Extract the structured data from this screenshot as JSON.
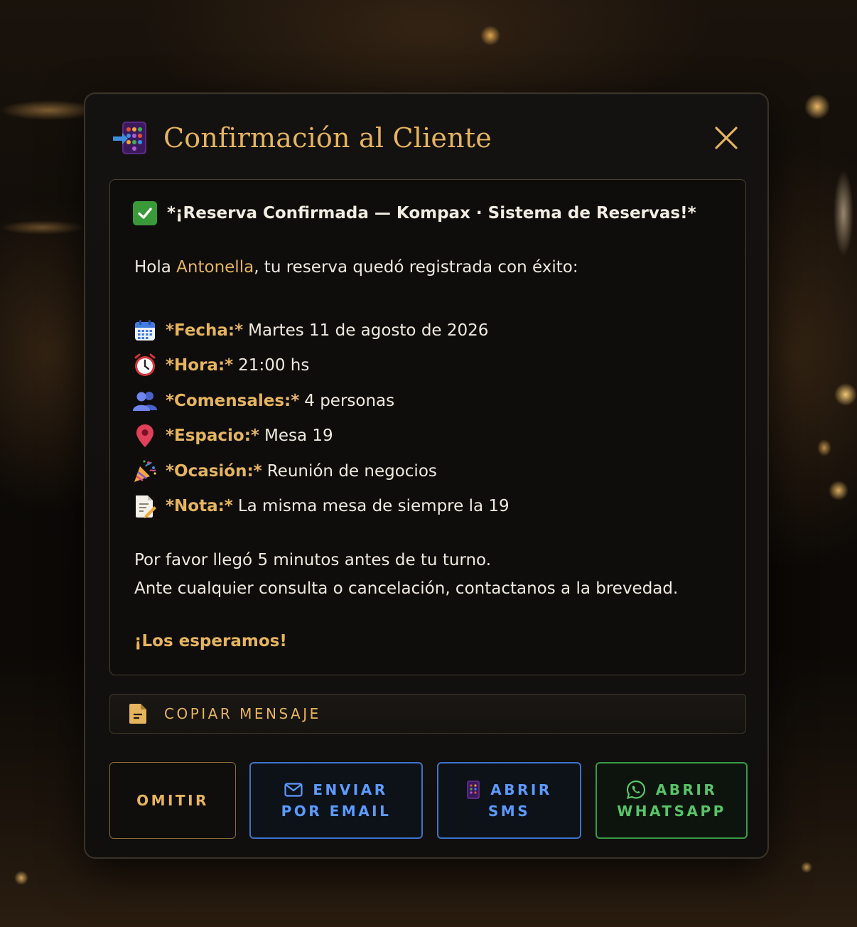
{
  "modal": {
    "title": "Confirmación al Cliente",
    "app_icon": "app-grid-icon",
    "close_icon": "close-icon"
  },
  "message": {
    "title": "*¡Reserva Confirmada — Kompax · Sistema de Reservas!*",
    "greeting_prefix": "Hola ",
    "customer_name": "Antonella",
    "greeting_suffix": ", tu reserva quedó registrada con éxito:",
    "details": [
      {
        "icon": "calendar-icon",
        "label": "*Fecha:*",
        "value": "Martes 11 de agosto de 2026"
      },
      {
        "icon": "alarm-clock-icon",
        "label": "*Hora:*",
        "value": "21:00 hs"
      },
      {
        "icon": "people-icon",
        "label": "*Comensales:*",
        "value": "4 personas"
      },
      {
        "icon": "location-pin-icon",
        "label": "*Espacio:*",
        "value": "Mesa 19"
      },
      {
        "icon": "party-popper-icon",
        "label": "*Ocasión:*",
        "value": "Reunión de negocios"
      },
      {
        "icon": "memo-icon",
        "label": "*Nota:*",
        "value": "La misma mesa de siempre la 19"
      }
    ],
    "note_line_1": "Por favor llegó 5 minutos antes de tu turno.",
    "note_line_2": "Ante cualquier consulta o cancelación, contactanos a la brevedad.",
    "closing": "¡Los esperamos!"
  },
  "copy_button": {
    "icon": "document-icon",
    "label": "COPIAR MENSAJE"
  },
  "actions": {
    "omit": {
      "label": "OMITIR"
    },
    "email": {
      "icon": "mail-icon",
      "line1": "ENVIAR",
      "line2": "POR EMAIL"
    },
    "sms": {
      "icon": "phone-icon",
      "line1": "ABRIR",
      "line2": "SMS"
    },
    "whatsapp": {
      "icon": "whatsapp-icon",
      "line1": "ABRIR",
      "line2": "WHATSAPP"
    }
  },
  "colors": {
    "accent_gold": "#e6b45f",
    "email_blue": "#5b9bff",
    "whatsapp_green": "#58c468",
    "check_green": "#3a9a3a"
  }
}
